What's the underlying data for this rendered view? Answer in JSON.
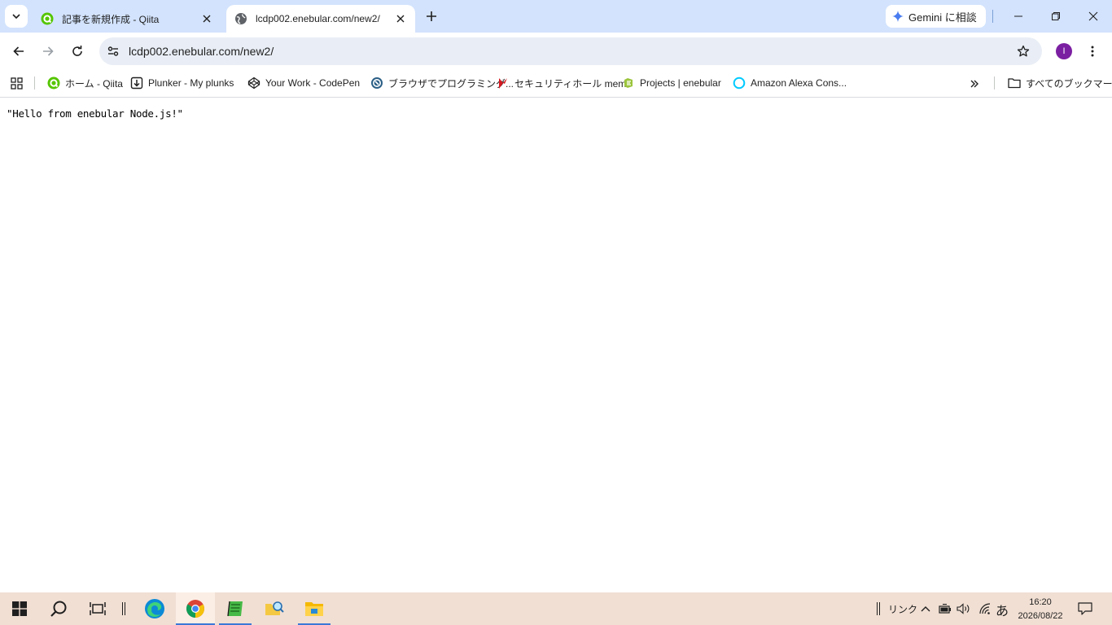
{
  "browser": {
    "tabs": [
      {
        "title": "記事を新規作成 - Qiita",
        "active": false,
        "favicon": "qiita-icon"
      },
      {
        "title": "lcdp002.enebular.com/new2/",
        "active": true,
        "favicon": "globe-icon"
      }
    ],
    "gemini_label": "Gemini に相談",
    "url": "lcdp002.enebular.com/new2/",
    "profile_initial": "I",
    "accent_color": "#d3e3fd"
  },
  "bookmarks": {
    "items": [
      {
        "label": "ホーム - Qiita",
        "icon": "qiita-icon"
      },
      {
        "label": "Plunker - My plunks",
        "icon": "plunker-icon"
      },
      {
        "label": "Your Work - CodePen",
        "icon": "codepen-icon"
      },
      {
        "label": "ブラウザでプログラミング...",
        "icon": "paiza-icon"
      },
      {
        "label": "セキュリティホール memo",
        "icon": "red-flag-icon"
      },
      {
        "label": "Projects | enebular",
        "icon": "enebular-icon"
      },
      {
        "label": "Amazon Alexa Cons...",
        "icon": "alexa-icon"
      }
    ],
    "all_bookmarks_label": "すべてのブックマーク"
  },
  "page": {
    "body_text": "\"Hello from enebular Node.js!\""
  },
  "taskbar": {
    "tray_link_label": "リンク",
    "ime_label": "あ",
    "time": "16:20",
    "date": "2026/08/22"
  }
}
